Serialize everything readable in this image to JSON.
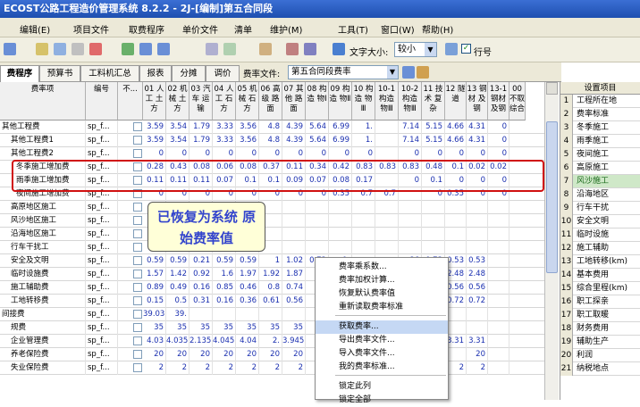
{
  "title": "ECOST公路工程造价管理系统 8.2.2 - 2J-[编制]第五合同段",
  "menu": [
    "编辑(E)",
    "项目文件",
    "取费程序",
    "单价文件",
    "清单",
    "维护(M)",
    "工具(T)",
    "窗口(W)",
    "帮助(H)"
  ],
  "toolbar": {
    "font_label": "文字大小:",
    "font_value": "较小",
    "row_label": "行号"
  },
  "tabs": [
    "费程序",
    "预算书",
    "工料机汇总",
    "报表",
    "分摊",
    "调价"
  ],
  "rate_file_label": "费率文件:",
  "rate_file_value": "第五合同段费率",
  "columns": [
    "费率项",
    "编号",
    "不...",
    "01 人工 土方",
    "02 机械 土方",
    "03 汽车 运输",
    "04 人工 石方",
    "05 机械 石方",
    "06 高级 路面",
    "07 其他 路面",
    "08 构造 物Ⅰ",
    "09 构造 物Ⅱ",
    "10 构造 物Ⅲ",
    "10-1 构造 物Ⅲ",
    "10-2 构造 物Ⅲ",
    "11 技术 复杂",
    "12 隧道",
    "13 钢材 及钢",
    "13-1 钢材 及钢",
    "00 不取 综合"
  ],
  "rows": [
    {
      "name": "其他工程费",
      "code": "sp_f...",
      "vals": [
        "3.59",
        "3.54",
        "1.79",
        "3.33",
        "3.56",
        "4.8",
        "4.39",
        "5.64",
        "6.99",
        "1.",
        "",
        "7.14",
        "5.15",
        "4.66",
        "4.31",
        "0"
      ]
    },
    {
      "name": "其他工程费1",
      "code": "sp_f...",
      "vals": [
        "3.59",
        "3.54",
        "1.79",
        "3.33",
        "3.56",
        "4.8",
        "4.39",
        "5.64",
        "6.99",
        "1.",
        "",
        "7.14",
        "5.15",
        "4.66",
        "4.31",
        "0"
      ]
    },
    {
      "name": "其他工程费2",
      "code": "sp_f...",
      "vals": [
        "0",
        "0",
        "0",
        "0",
        "0",
        "0",
        "0",
        "0",
        "0",
        "0",
        "",
        "0",
        "0",
        "0",
        "0",
        "0"
      ]
    },
    {
      "name": "冬季施工增加费",
      "code": "sp_f...",
      "vals": [
        "0.28",
        "0.43",
        "0.08",
        "0.06",
        "0.08",
        "0.37",
        "0.11",
        "0.34",
        "0.42",
        "0.83",
        "0.83",
        "0.83",
        "0.48",
        "0.1",
        "0.02",
        "0.02"
      ]
    },
    {
      "name": "雨季施工增加费",
      "code": "sp_f...",
      "vals": [
        "0.11",
        "0.11",
        "0.11",
        "0.07",
        "0.1",
        "0.1",
        "0.09",
        "0.07",
        "0.08",
        "0.17",
        "",
        "0",
        "0.1",
        "0",
        "0",
        "0"
      ]
    },
    {
      "name": "夜间施工增加费",
      "code": "sp_f...",
      "vals": [
        "0",
        "0",
        "0",
        "0",
        "0",
        "0",
        "0",
        "0",
        "0.35",
        "0.7",
        "0.7",
        "",
        "0",
        "0.35",
        "0",
        "0"
      ]
    },
    {
      "name": "高原地区施工",
      "code": "sp_f...",
      "vals": [
        "",
        "",
        "",
        "",
        "",
        "",
        "",
        "",
        "",
        "",
        "",
        "",
        "",
        "",
        "",
        ""
      ]
    },
    {
      "name": "风沙地区施工",
      "code": "sp_f...",
      "vals": [
        "",
        "",
        "",
        "",
        "",
        "",
        "",
        "",
        "",
        "",
        "",
        "",
        "",
        "",
        "",
        ""
      ]
    },
    {
      "name": "沿海地区施工",
      "code": "sp_f...",
      "vals": [
        "",
        "",
        "",
        "",
        "",
        "",
        "",
        "",
        "",
        "",
        "",
        "",
        "",
        "",
        "",
        ""
      ]
    },
    {
      "name": "行车干扰工",
      "code": "sp_f...",
      "vals": [
        "",
        "",
        "",
        "",
        "",
        "",
        "",
        "",
        "",
        "",
        "",
        "",
        "",
        "",
        "",
        ""
      ]
    },
    {
      "name": "安全及文明",
      "code": "sp_f...",
      "vals": [
        "0.59",
        "0.59",
        "0.21",
        "0.59",
        "0.59",
        "1",
        "1.02",
        "0.72",
        "0.",
        "",
        "",
        "86",
        "0.73",
        "0.53",
        "0.53",
        ""
      ]
    },
    {
      "name": "临时设施费",
      "code": "sp_f...",
      "vals": [
        "1.57",
        "1.42",
        "0.92",
        "1.6",
        "1.97",
        "1.92",
        "1.87",
        "",
        "",
        "",
        "",
        "92",
        "2.57",
        "2.48",
        "2.48",
        ""
      ]
    },
    {
      "name": "施工辅助费",
      "code": "sp_f...",
      "vals": [
        "0.89",
        "0.49",
        "0.16",
        "0.85",
        "0.46",
        "0.8",
        "0.74",
        "",
        "",
        "",
        "",
        "68",
        "1.23",
        "0.56",
        "0.56",
        ""
      ]
    },
    {
      "name": "工地转移费",
      "code": "sp_f...",
      "vals": [
        "0.15",
        "0.5",
        "0.31",
        "0.16",
        "0.36",
        "0.61",
        "0.56",
        "",
        "",
        "",
        "",
        "75",
        "0.52",
        "0.72",
        "0.72",
        ""
      ]
    },
    {
      "name": "间接费",
      "code": "sp_f...",
      "vals": [
        "39.03",
        "39.",
        "",
        "",
        "",
        "",
        "",
        "",
        "",
        "",
        "",
        "",
        "",
        "",
        "",
        ""
      ]
    },
    {
      "name": "规费",
      "code": "sp_f...",
      "vals": [
        "35",
        "35",
        "35",
        "35",
        "35",
        "35",
        "35",
        "",
        "",
        "",
        "",
        "",
        "",
        "",
        "",
        ""
      ]
    },
    {
      "name": "企业管理费",
      "code": "sp_f...",
      "vals": [
        "4.03",
        "4.035",
        "2.135",
        "4.045",
        "4.04",
        "2.",
        "3.945",
        "",
        "",
        "",
        "",
        "66",
        "5.",
        "3.31",
        "3.31",
        ""
      ]
    },
    {
      "name": "养老保险费",
      "code": "sp_f...",
      "vals": [
        "20",
        "20",
        "20",
        "20",
        "20",
        "20",
        "20",
        "",
        "",
        "",
        "",
        "",
        "20",
        "",
        "20",
        ""
      ]
    },
    {
      "name": "失业保险费",
      "code": "sp_f...",
      "vals": [
        "2",
        "2",
        "2",
        "2",
        "2",
        "2",
        "2",
        "",
        "",
        "",
        "",
        "",
        "2",
        "2",
        "2",
        ""
      ]
    }
  ],
  "annotation": "已恢复为系统 原始费率值",
  "context_menu": [
    "费率乘系数...",
    "费率加权计算...",
    "恢复默认费率值",
    "重新读取费率标准",
    "获取费率...",
    "导出费率文件...",
    "导入费率文件...",
    "我的费率标准...",
    "锁定此列",
    "锁定全部"
  ],
  "right_panel": {
    "header": "设置项目",
    "items": [
      "工程所在地",
      "费率标准",
      "冬季施工",
      "雨季施工",
      "夜间施工",
      "高原施工",
      "风沙施工",
      "沿海地区",
      "行车干扰",
      "安全文明",
      "临时设施",
      "施工辅助",
      "工地转移(km)",
      "基本费用",
      "综合里程(km)",
      "职工探亲",
      "职工取暖",
      "财务费用",
      "辅助生产",
      "利润",
      "纳税地点"
    ],
    "selected": 7
  }
}
